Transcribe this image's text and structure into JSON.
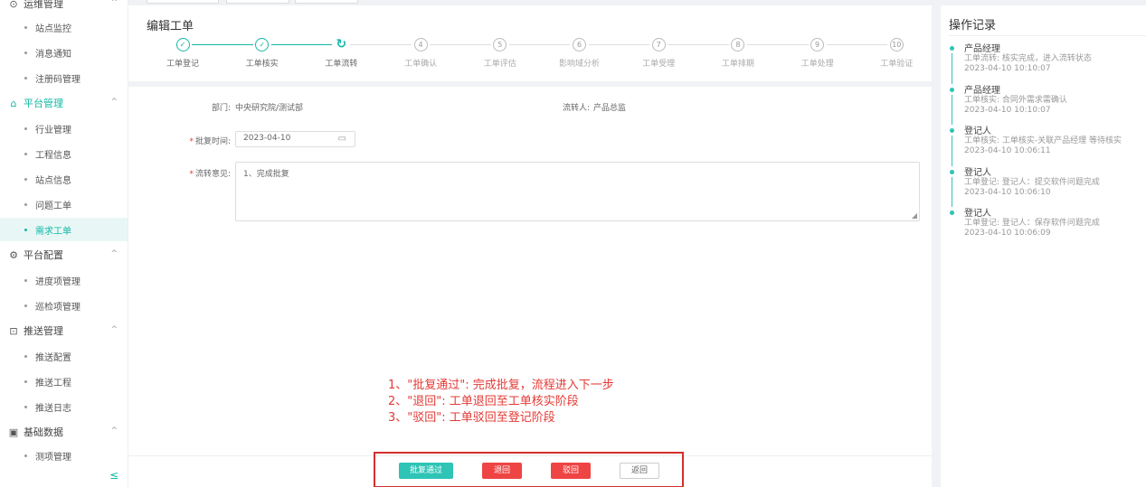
{
  "sidebar": {
    "groups": [
      {
        "icon": "monitor-icon",
        "label": "运维管理",
        "items": [
          "站点监控",
          "消息通知",
          "注册码管理"
        ]
      },
      {
        "icon": "platform-icon",
        "label": "平台管理",
        "items": [
          "行业管理",
          "工程信息",
          "站点信息",
          "问题工单",
          "需求工单"
        ],
        "active_item": "需求工单"
      },
      {
        "icon": "config-icon",
        "label": "平台配置",
        "items": [
          "进度项管理",
          "巡检项管理"
        ]
      },
      {
        "icon": "push-icon",
        "label": "推送管理",
        "items": [
          "推送配置",
          "推送工程",
          "推送日志"
        ]
      },
      {
        "icon": "database-icon",
        "label": "基础数据",
        "items": [
          "测项管理"
        ]
      }
    ],
    "collapse_icon": "collapse-menu-icon"
  },
  "main": {
    "title": "编辑工单",
    "steps": [
      {
        "num": "1",
        "label": "工单登记",
        "state": "done"
      },
      {
        "num": "2",
        "label": "工单核实",
        "state": "done"
      },
      {
        "num": "3",
        "label": "工单流转",
        "state": "current"
      },
      {
        "num": "4",
        "label": "工单确认",
        "state": "todo"
      },
      {
        "num": "5",
        "label": "工单评估",
        "state": "todo"
      },
      {
        "num": "6",
        "label": "影响域分析",
        "state": "todo"
      },
      {
        "num": "7",
        "label": "工单受理",
        "state": "todo"
      },
      {
        "num": "8",
        "label": "工单排期",
        "state": "todo"
      },
      {
        "num": "9",
        "label": "工单处理",
        "state": "todo"
      },
      {
        "num": "10",
        "label": "工单验证",
        "state": "todo"
      }
    ],
    "form": {
      "dept_label": "部门:",
      "dept_value": "中央研究院/测试部",
      "transfer_label": "流转人:",
      "transfer_value": "产品总监",
      "approve_time_label": "批复时间:",
      "approve_time_value": "2023-04-10",
      "opinion_label": "流转意见:",
      "opinion_value": "1、完成批复"
    },
    "annotation": "1、\"批复通过\": 完成批复，流程进入下一步\n2、\"退回\": 工单退回至工单核实阶段\n3、\"驳回\": 工单驳回至登记阶段",
    "buttons": {
      "approve": "批复通过",
      "return": "退回",
      "reject": "驳回",
      "back": "返回"
    }
  },
  "log": {
    "title": "操作记录",
    "entries": [
      {
        "who": "产品经理",
        "desc": "工单流转: 核实完成，进入流转状态",
        "time": "2023-04-10 10:10:07"
      },
      {
        "who": "产品经理",
        "desc": "工单核实: 合同外需求需确认",
        "time": "2023-04-10 10:10:07"
      },
      {
        "who": "登记人",
        "desc": "工单核实: 工单核实-关联产品经理 等待核实",
        "time": "2023-04-10 10:06:11"
      },
      {
        "who": "登记人",
        "desc": "工单登记: 登记人：提交软件问题完成",
        "time": "2023-04-10 10:06:10"
      },
      {
        "who": "登记人",
        "desc": "工单登记: 登记人：保存软件问题完成",
        "time": "2023-04-10 10:06:09"
      }
    ]
  },
  "colors": {
    "accent": "#14b8a6",
    "danger": "#ef4444",
    "highlight_box": "#d32f2f"
  }
}
